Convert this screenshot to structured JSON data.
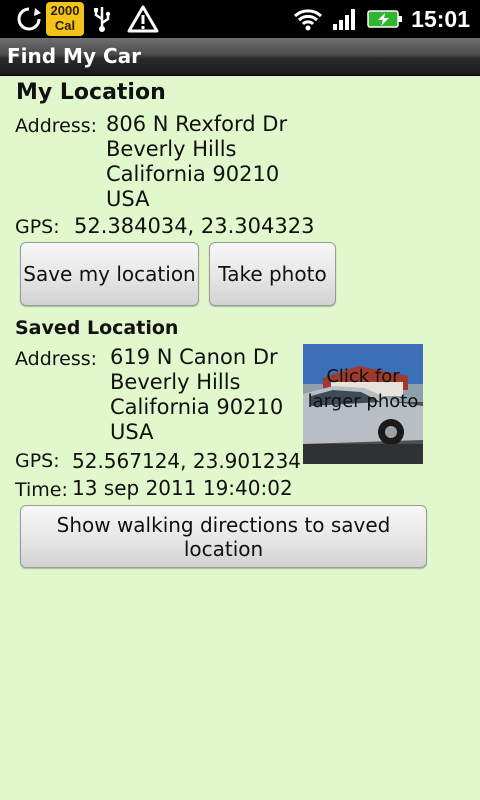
{
  "status_bar": {
    "calorie_badge_top": "2000",
    "calorie_badge_bottom": "Cal",
    "time": "15:01",
    "icons": [
      "sync-icon",
      "usb-icon",
      "warning-icon",
      "wifi-icon",
      "signal-icon",
      "battery-charging-icon"
    ]
  },
  "title_bar": {
    "title": "Find My Car"
  },
  "my_location": {
    "heading": "My Location",
    "address_label": "Address:",
    "address_lines": [
      "806 N Rexford Dr",
      "Beverly Hills",
      "California 90210",
      "USA"
    ],
    "gps_label": "GPS:",
    "gps_value": "52.384034, 23.304323",
    "save_button": "Save my location",
    "photo_button": "Take photo"
  },
  "saved_location": {
    "heading": "Saved Location",
    "address_label": "Address:",
    "address_lines": [
      "619 N Canon Dr",
      "Beverly Hills",
      "California 90210",
      "USA"
    ],
    "gps_label": "GPS:",
    "gps_value": "52.567124, 23.901234",
    "time_label": "Time:",
    "time_value": "13 sep 2011 19:40:02",
    "photo_caption": "Click for larger photo",
    "directions_button": "Show walking directions to saved location"
  },
  "colors": {
    "background": "#e1f8cc",
    "statusbar": "#000000",
    "badge": "#f2c41a"
  }
}
